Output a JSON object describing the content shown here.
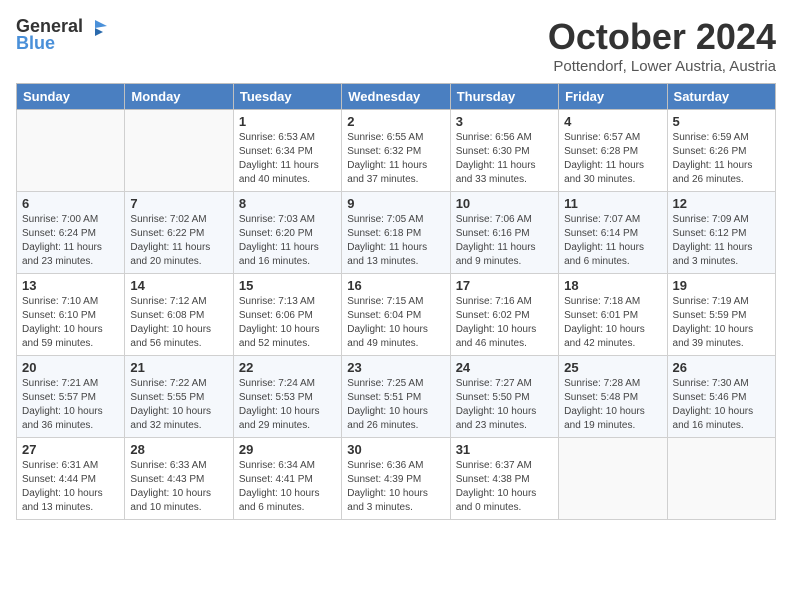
{
  "logo": {
    "general": "General",
    "blue": "Blue"
  },
  "title": "October 2024",
  "location": "Pottendorf, Lower Austria, Austria",
  "headers": [
    "Sunday",
    "Monday",
    "Tuesday",
    "Wednesday",
    "Thursday",
    "Friday",
    "Saturday"
  ],
  "weeks": [
    [
      {
        "day": "",
        "info": ""
      },
      {
        "day": "",
        "info": ""
      },
      {
        "day": "1",
        "info": "Sunrise: 6:53 AM\nSunset: 6:34 PM\nDaylight: 11 hours\nand 40 minutes."
      },
      {
        "day": "2",
        "info": "Sunrise: 6:55 AM\nSunset: 6:32 PM\nDaylight: 11 hours\nand 37 minutes."
      },
      {
        "day": "3",
        "info": "Sunrise: 6:56 AM\nSunset: 6:30 PM\nDaylight: 11 hours\nand 33 minutes."
      },
      {
        "day": "4",
        "info": "Sunrise: 6:57 AM\nSunset: 6:28 PM\nDaylight: 11 hours\nand 30 minutes."
      },
      {
        "day": "5",
        "info": "Sunrise: 6:59 AM\nSunset: 6:26 PM\nDaylight: 11 hours\nand 26 minutes."
      }
    ],
    [
      {
        "day": "6",
        "info": "Sunrise: 7:00 AM\nSunset: 6:24 PM\nDaylight: 11 hours\nand 23 minutes."
      },
      {
        "day": "7",
        "info": "Sunrise: 7:02 AM\nSunset: 6:22 PM\nDaylight: 11 hours\nand 20 minutes."
      },
      {
        "day": "8",
        "info": "Sunrise: 7:03 AM\nSunset: 6:20 PM\nDaylight: 11 hours\nand 16 minutes."
      },
      {
        "day": "9",
        "info": "Sunrise: 7:05 AM\nSunset: 6:18 PM\nDaylight: 11 hours\nand 13 minutes."
      },
      {
        "day": "10",
        "info": "Sunrise: 7:06 AM\nSunset: 6:16 PM\nDaylight: 11 hours\nand 9 minutes."
      },
      {
        "day": "11",
        "info": "Sunrise: 7:07 AM\nSunset: 6:14 PM\nDaylight: 11 hours\nand 6 minutes."
      },
      {
        "day": "12",
        "info": "Sunrise: 7:09 AM\nSunset: 6:12 PM\nDaylight: 11 hours\nand 3 minutes."
      }
    ],
    [
      {
        "day": "13",
        "info": "Sunrise: 7:10 AM\nSunset: 6:10 PM\nDaylight: 10 hours\nand 59 minutes."
      },
      {
        "day": "14",
        "info": "Sunrise: 7:12 AM\nSunset: 6:08 PM\nDaylight: 10 hours\nand 56 minutes."
      },
      {
        "day": "15",
        "info": "Sunrise: 7:13 AM\nSunset: 6:06 PM\nDaylight: 10 hours\nand 52 minutes."
      },
      {
        "day": "16",
        "info": "Sunrise: 7:15 AM\nSunset: 6:04 PM\nDaylight: 10 hours\nand 49 minutes."
      },
      {
        "day": "17",
        "info": "Sunrise: 7:16 AM\nSunset: 6:02 PM\nDaylight: 10 hours\nand 46 minutes."
      },
      {
        "day": "18",
        "info": "Sunrise: 7:18 AM\nSunset: 6:01 PM\nDaylight: 10 hours\nand 42 minutes."
      },
      {
        "day": "19",
        "info": "Sunrise: 7:19 AM\nSunset: 5:59 PM\nDaylight: 10 hours\nand 39 minutes."
      }
    ],
    [
      {
        "day": "20",
        "info": "Sunrise: 7:21 AM\nSunset: 5:57 PM\nDaylight: 10 hours\nand 36 minutes."
      },
      {
        "day": "21",
        "info": "Sunrise: 7:22 AM\nSunset: 5:55 PM\nDaylight: 10 hours\nand 32 minutes."
      },
      {
        "day": "22",
        "info": "Sunrise: 7:24 AM\nSunset: 5:53 PM\nDaylight: 10 hours\nand 29 minutes."
      },
      {
        "day": "23",
        "info": "Sunrise: 7:25 AM\nSunset: 5:51 PM\nDaylight: 10 hours\nand 26 minutes."
      },
      {
        "day": "24",
        "info": "Sunrise: 7:27 AM\nSunset: 5:50 PM\nDaylight: 10 hours\nand 23 minutes."
      },
      {
        "day": "25",
        "info": "Sunrise: 7:28 AM\nSunset: 5:48 PM\nDaylight: 10 hours\nand 19 minutes."
      },
      {
        "day": "26",
        "info": "Sunrise: 7:30 AM\nSunset: 5:46 PM\nDaylight: 10 hours\nand 16 minutes."
      }
    ],
    [
      {
        "day": "27",
        "info": "Sunrise: 6:31 AM\nSunset: 4:44 PM\nDaylight: 10 hours\nand 13 minutes."
      },
      {
        "day": "28",
        "info": "Sunrise: 6:33 AM\nSunset: 4:43 PM\nDaylight: 10 hours\nand 10 minutes."
      },
      {
        "day": "29",
        "info": "Sunrise: 6:34 AM\nSunset: 4:41 PM\nDaylight: 10 hours\nand 6 minutes."
      },
      {
        "day": "30",
        "info": "Sunrise: 6:36 AM\nSunset: 4:39 PM\nDaylight: 10 hours\nand 3 minutes."
      },
      {
        "day": "31",
        "info": "Sunrise: 6:37 AM\nSunset: 4:38 PM\nDaylight: 10 hours\nand 0 minutes."
      },
      {
        "day": "",
        "info": ""
      },
      {
        "day": "",
        "info": ""
      }
    ]
  ]
}
